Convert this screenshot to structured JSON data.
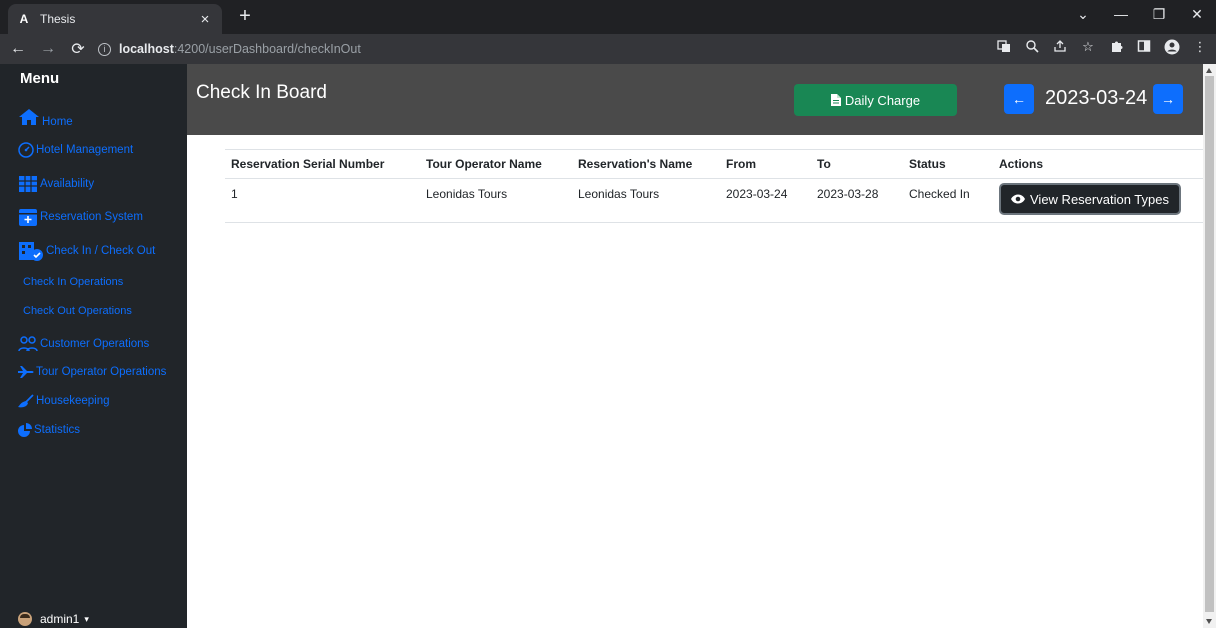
{
  "browser": {
    "tab_favicon": "A",
    "tab_title": "Thesis",
    "tab_close": "×",
    "new_tab": "+",
    "url_host": "localhost",
    "url_rest": ":4200/userDashboard/checkInOut",
    "win_controls": [
      "⌄",
      "—",
      "❐",
      "✕"
    ]
  },
  "sidebar": {
    "title": "Menu",
    "items": [
      {
        "label": "Home",
        "icon": "home-icon"
      },
      {
        "label": "Hotel Management",
        "icon": "gauge-icon"
      },
      {
        "label": "Availability",
        "icon": "table-icon"
      },
      {
        "label": "Reservation System",
        "icon": "calendar-plus-icon"
      },
      {
        "label": "Check In / Check Out",
        "icon": "hotel-check-icon"
      },
      {
        "label": "Check In Operations"
      },
      {
        "label": "Check Out Operations"
      },
      {
        "label": "Customer Operations",
        "icon": "users-icon"
      },
      {
        "label": "Tour Operator Operations",
        "icon": "plane-icon"
      },
      {
        "label": "Housekeeping",
        "icon": "broom-icon"
      },
      {
        "label": "Statistics",
        "icon": "pie-chart-icon"
      }
    ],
    "user": "admin1"
  },
  "board": {
    "title": "Check In Board",
    "daily_charge": "Daily Charge",
    "date": "2023-03-24",
    "prev_arrow": "←",
    "next_arrow": "→"
  },
  "table": {
    "headers": [
      "Reservation Serial Number",
      "Tour Operator Name",
      "Reservation's Name",
      "From",
      "To",
      "Status",
      "Actions"
    ],
    "rows": [
      {
        "serial": "1",
        "tour_operator": "Leonidas Tours",
        "reservation_name": "Leonidas Tours",
        "from": "2023-03-24",
        "to": "2023-03-28",
        "status": "Checked In",
        "action": "View Reservation Types"
      }
    ]
  },
  "colors": {
    "sidebar_bg": "#212529",
    "link_blue": "#0d6efd",
    "header_bg": "#4a4a4a",
    "success": "#198754"
  }
}
